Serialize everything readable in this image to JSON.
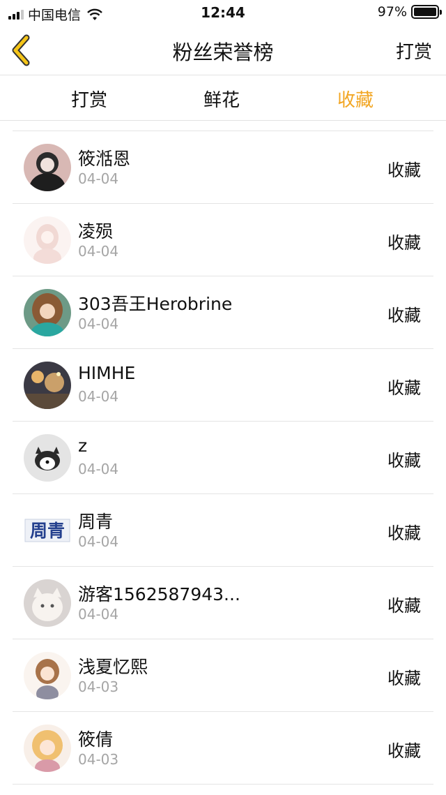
{
  "status_bar": {
    "carrier": "中国电信",
    "time": "12:44",
    "battery": "97%"
  },
  "nav": {
    "back_icon": "chevron-left-icon",
    "title": "粉丝荣誉榜",
    "action": "打赏"
  },
  "tabs": [
    {
      "label": "打赏",
      "active": false
    },
    {
      "label": "鲜花",
      "active": false
    },
    {
      "label": "收藏",
      "active": true
    }
  ],
  "colors": {
    "accent": "#f2a623",
    "back_icon_fill": "#f5c518",
    "divider": "#e4e4e4",
    "date_text": "#a5a5a5"
  },
  "fans": [
    {
      "name": "筱湉恩",
      "date": "04-04",
      "type": "收藏"
    },
    {
      "name": "凌殒",
      "date": "04-04",
      "type": "收藏"
    },
    {
      "name": "303吾王Herobrine",
      "date": "04-04",
      "type": "收藏"
    },
    {
      "name": "HIMHE",
      "date": "04-04",
      "type": "收藏"
    },
    {
      "name": "z",
      "date": "04-04",
      "type": "收藏"
    },
    {
      "name": "周青",
      "date": "04-04",
      "type": "收藏",
      "avatar_text": "周青"
    },
    {
      "name": "游客1562587943...",
      "date": "04-04",
      "type": "收藏"
    },
    {
      "name": "浅夏忆熙",
      "date": "04-03",
      "type": "收藏"
    },
    {
      "name": "筱倩",
      "date": "04-03",
      "type": "收藏"
    }
  ]
}
